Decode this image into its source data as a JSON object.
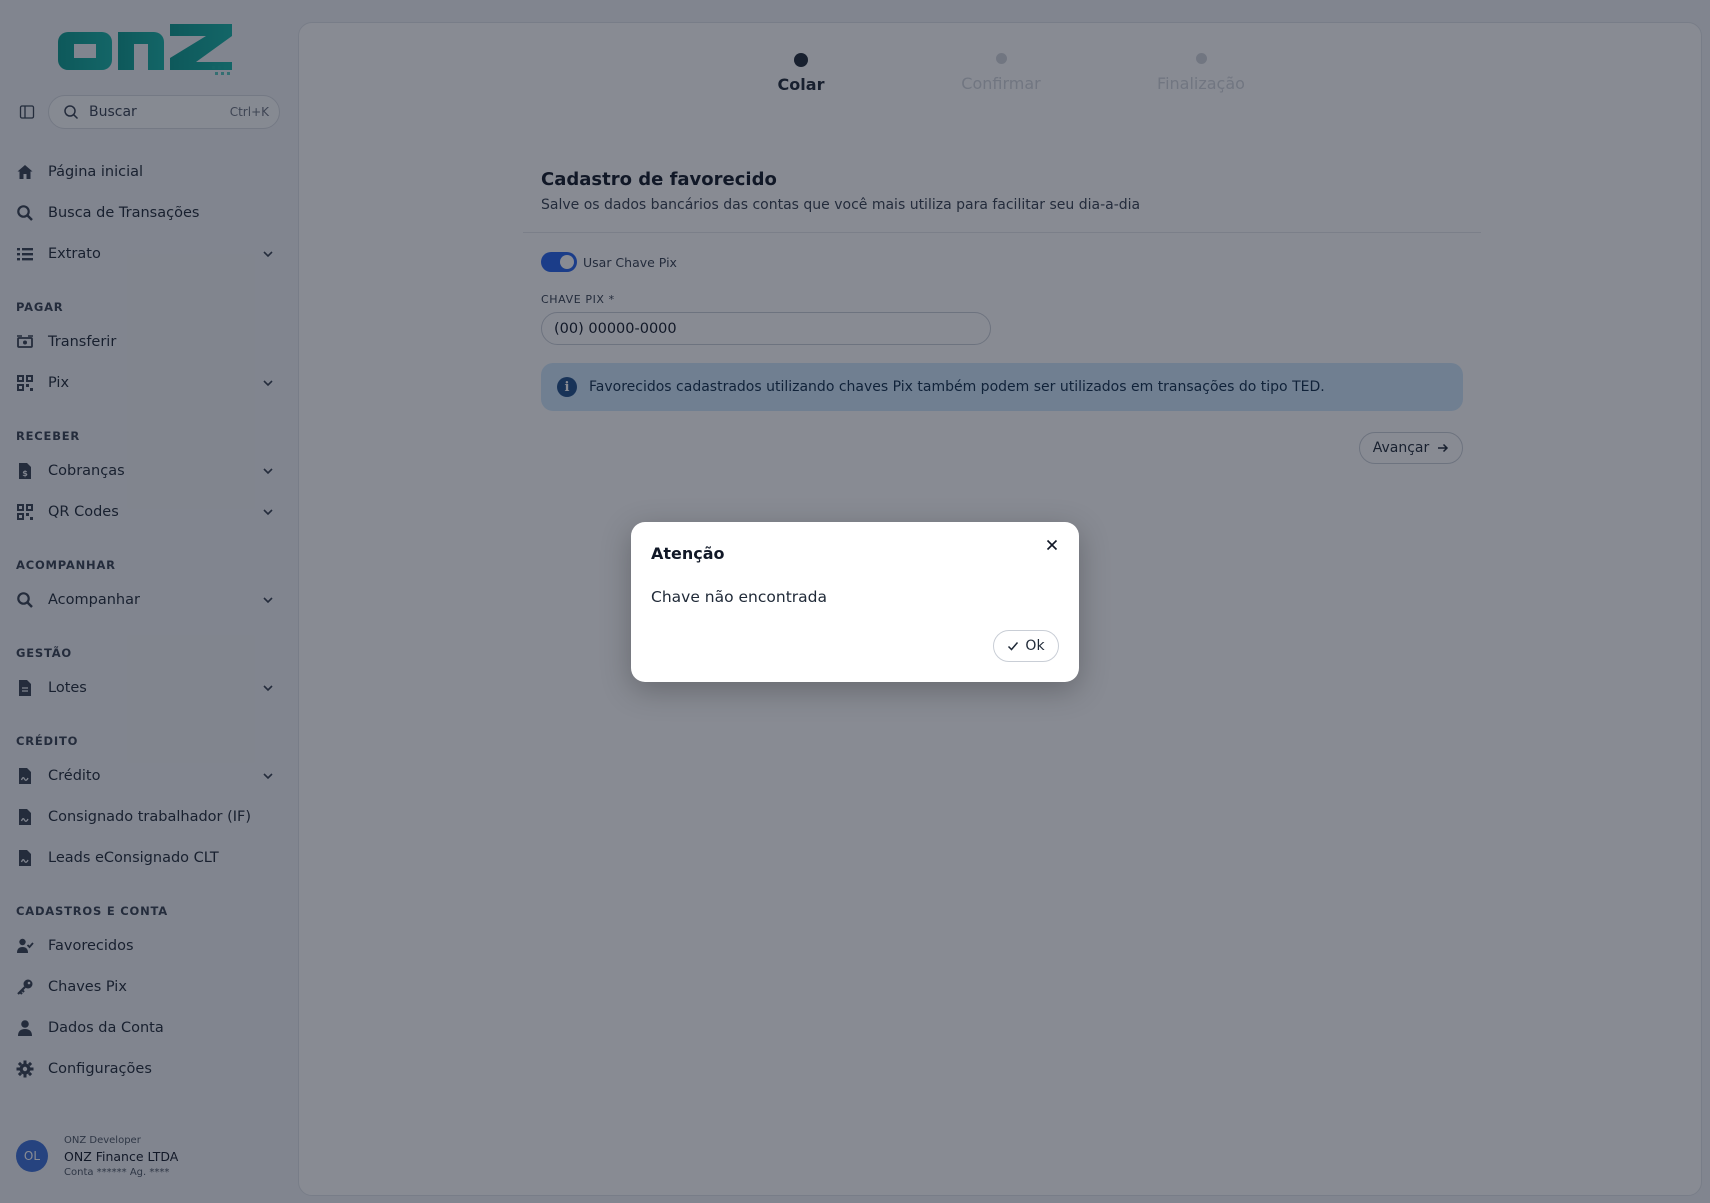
{
  "app": {
    "logo_text": "onz"
  },
  "search": {
    "label": "Buscar",
    "shortcut": "Ctrl+K"
  },
  "nav": {
    "items_top": [
      {
        "label": "Página inicial",
        "icon": "home-icon"
      },
      {
        "label": "Busca de Transações",
        "icon": "search-icon"
      },
      {
        "label": "Extrato",
        "icon": "list-icon"
      }
    ],
    "sections": {
      "pagar": "PAGAR",
      "receber": "RECEBER",
      "acompanhar": "ACOMPANHAR",
      "gestao": "GESTÃO",
      "credito": "CRÉDITO",
      "cadastros": "CADASTROS E CONTA"
    },
    "pagar": [
      {
        "label": "Transferir"
      },
      {
        "label": "Pix"
      }
    ],
    "receber": [
      {
        "label": "Cobranças"
      },
      {
        "label": "QR Codes"
      }
    ],
    "acompanhar": [
      {
        "label": "Acompanhar"
      }
    ],
    "gestao": [
      {
        "label": "Lotes"
      }
    ],
    "credito": [
      {
        "label": "Crédito"
      },
      {
        "label": "Consignado trabalhador (IF)"
      },
      {
        "label": "Leads eConsignado CLT"
      }
    ],
    "cadastros": [
      {
        "label": "Favorecidos"
      },
      {
        "label": "Chaves Pix"
      },
      {
        "label": "Dados da Conta"
      },
      {
        "label": "Configurações"
      }
    ]
  },
  "user": {
    "initials": "OL",
    "role": "ONZ Developer",
    "company": "ONZ Finance LTDA",
    "account": "Conta ****** Ag. ****"
  },
  "stepper": [
    {
      "label": "Colar",
      "state": "active"
    },
    {
      "label": "Confirmar",
      "state": "inactive"
    },
    {
      "label": "Finalização",
      "state": "inactive"
    }
  ],
  "form": {
    "title": "Cadastro de favorecido",
    "subtitle": "Salve os dados bancários das contas que você mais utiliza para facilitar seu dia-a-dia",
    "toggle_label": "Usar Chave Pix",
    "toggle_on": true,
    "field_label": "CHAVE PIX  *",
    "field_value": "(00) 00000-0000",
    "info": "Favorecidos cadastrados utilizando chaves Pix também podem ser utilizados em transações do tipo TED.",
    "advance_label": "Avançar"
  },
  "modal": {
    "title": "Atenção",
    "message": "Chave não encontrada",
    "ok_label": "Ok"
  },
  "colors": {
    "brand": "#0fa39a",
    "accent": "#2563eb",
    "info_bg": "#cfe6fb"
  }
}
